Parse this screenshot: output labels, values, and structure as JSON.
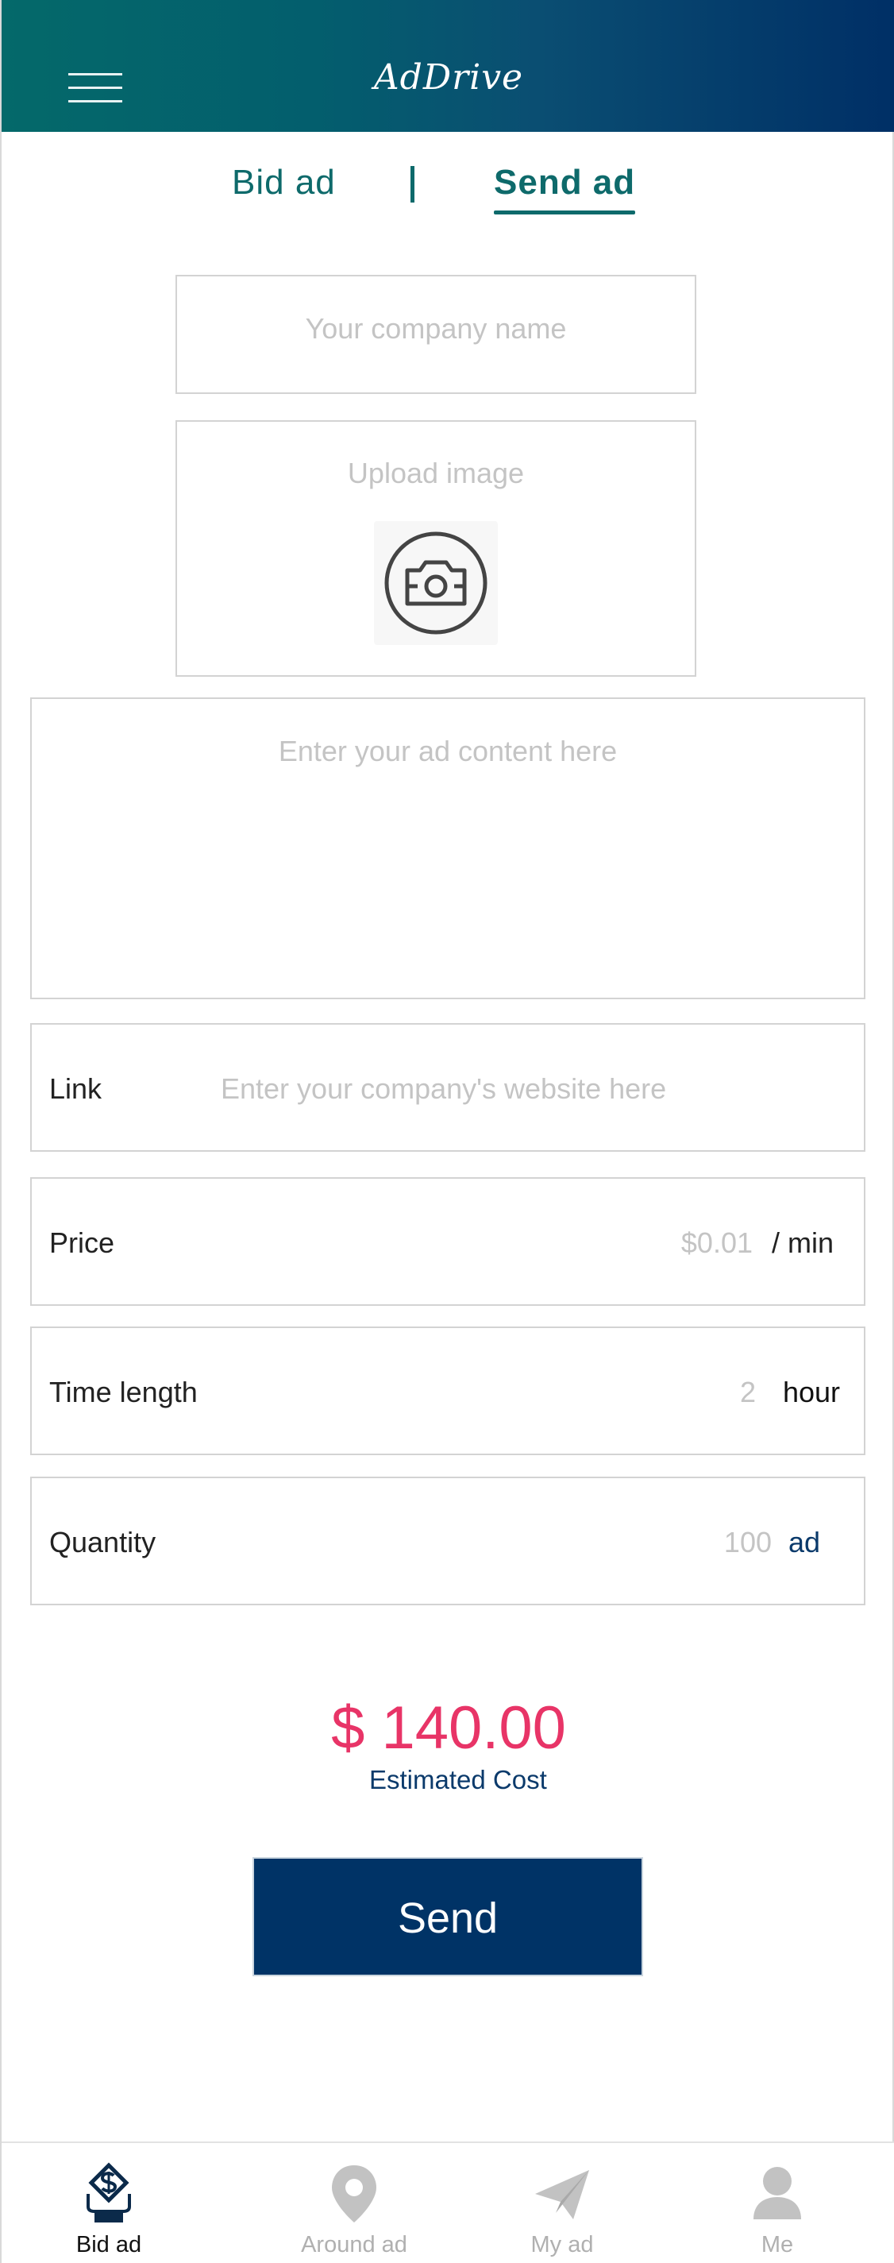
{
  "app": {
    "title": "AdDrive"
  },
  "tabs": {
    "bid": "Bid ad",
    "send": "Send ad"
  },
  "form": {
    "company_placeholder": "Your company name",
    "upload_label": "Upload image",
    "content_placeholder": "Enter your ad content here",
    "link_label": "Link",
    "link_placeholder": "Enter your company's website here",
    "price_label": "Price",
    "price_value": "$0.01",
    "price_unit": "/ min",
    "time_label": "Time length",
    "time_value": "2",
    "time_unit": "hour",
    "quantity_label": "Quantity",
    "quantity_value": "100",
    "quantity_unit": "ad"
  },
  "cost": {
    "amount": "$ 140.00",
    "label": "Estimated Cost"
  },
  "send_button": "Send",
  "bottom_nav": {
    "items": [
      {
        "label": "Bid ad",
        "icon": "bid-ad-icon",
        "active": true
      },
      {
        "label": "Around ad",
        "icon": "location-pin-icon",
        "active": false
      },
      {
        "label": "My ad",
        "icon": "paper-plane-icon",
        "active": false
      },
      {
        "label": "Me",
        "icon": "user-icon",
        "active": false
      }
    ]
  },
  "colors": {
    "header_start": "#04696a",
    "header_end": "#002f66",
    "accent": "#0e6a6b",
    "cost": "#e83467",
    "button": "#003366"
  }
}
